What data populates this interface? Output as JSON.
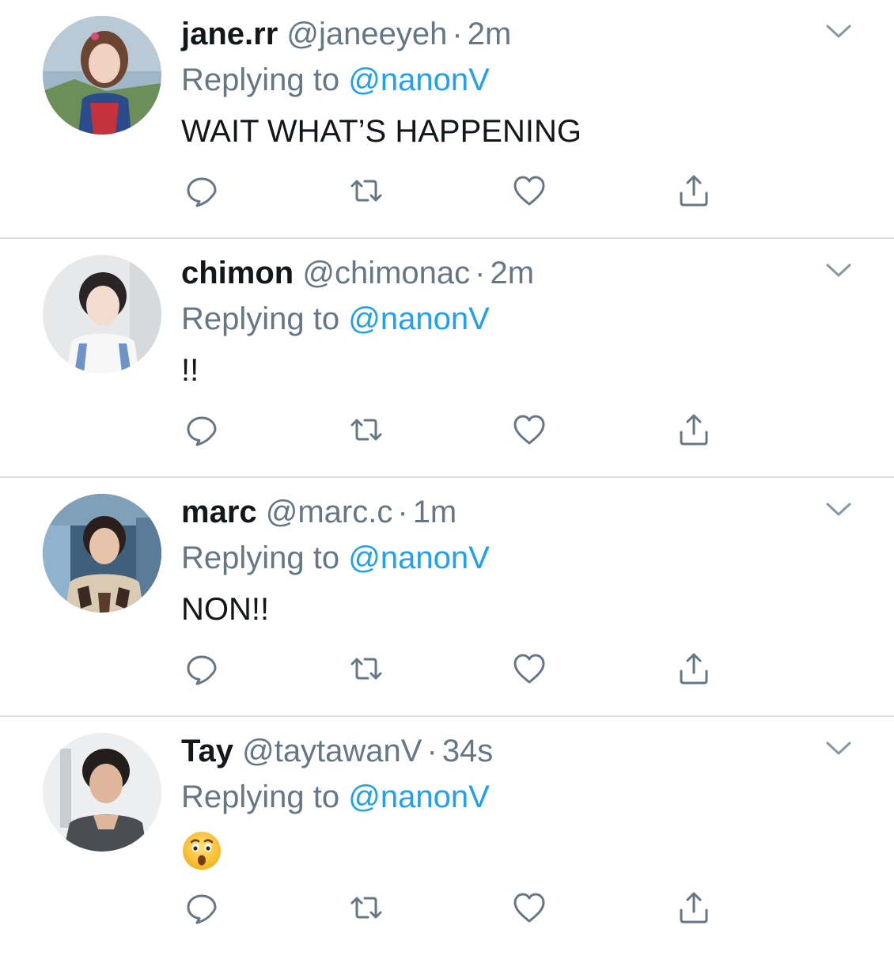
{
  "theme": {
    "handle_color": "#657786",
    "link_color": "#1da1f2",
    "text_color": "#14171a",
    "icon_color": "#657786",
    "divider_color": "#dcdfe2"
  },
  "icons": {
    "reply": "comment-bubble-icon",
    "retweet": "retweet-icon",
    "like": "heart-icon",
    "share": "share-icon",
    "more": "chevron-down-icon"
  },
  "tweets": [
    {
      "display_name": "jane.rr",
      "handle": "@janeeyeh",
      "separator": "·",
      "time": "2m",
      "replying_prefix": "Replying to",
      "replying_to": "@nanonV",
      "text": "WAIT WHAT’S HAPPENING"
    },
    {
      "display_name": "chimon",
      "handle": "@chimonac",
      "separator": "·",
      "time": "2m",
      "replying_prefix": "Replying to",
      "replying_to": "@nanonV",
      "text": "!!"
    },
    {
      "display_name": "marc",
      "handle": "@marc.c",
      "separator": "·",
      "time": "1m",
      "replying_prefix": "Replying to",
      "replying_to": "@nanonV",
      "text": "NON!!"
    },
    {
      "display_name": "Tay",
      "handle": "@taytawanV",
      "separator": "·",
      "time": "34s",
      "replying_prefix": "Replying to",
      "replying_to": "@nanonV",
      "text": "",
      "emoji": "astonished-face-emoji"
    }
  ]
}
